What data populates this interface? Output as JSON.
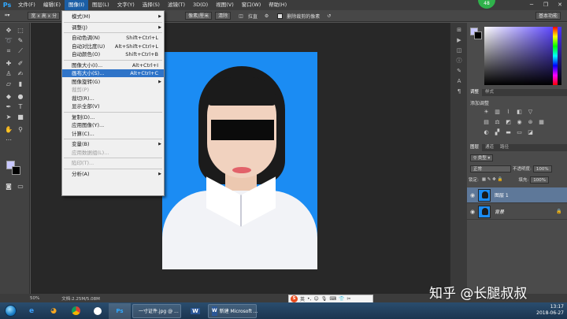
{
  "app": {
    "logo": "Ps"
  },
  "menubar": {
    "items": [
      "文件(F)",
      "编辑(E)",
      "图像(I)",
      "图层(L)",
      "文字(Y)",
      "选择(S)",
      "滤镜(T)",
      "3D(D)",
      "视图(V)",
      "窗口(W)",
      "帮助(H)"
    ],
    "active_index": 2,
    "notification_badge": "48"
  },
  "options_bar": {
    "ratio": "宽 x 高 x 分",
    "unit": "像素/厘米",
    "clear_label": "清除",
    "straighten_label": "拉直",
    "delete_cropped_label": "删除裁剪的像素",
    "workspace": "基本功能"
  },
  "image_menu": {
    "items": [
      {
        "label": "模式(M)",
        "shortcut": "",
        "submenu": true
      },
      {
        "sep": true
      },
      {
        "label": "调整(J)",
        "shortcut": "",
        "submenu": true
      },
      {
        "sep": true
      },
      {
        "label": "自动色调(N)",
        "shortcut": "Shift+Ctrl+L"
      },
      {
        "label": "自动对比度(U)",
        "shortcut": "Alt+Shift+Ctrl+L"
      },
      {
        "label": "自动颜色(O)",
        "shortcut": "Shift+Ctrl+B"
      },
      {
        "sep": true
      },
      {
        "label": "图像大小(I)...",
        "shortcut": "Alt+Ctrl+I"
      },
      {
        "label": "画布大小(S)...",
        "shortcut": "Alt+Ctrl+C",
        "highlight": true
      },
      {
        "label": "图像旋转(G)",
        "shortcut": "",
        "submenu": true
      },
      {
        "label": "裁剪(P)",
        "shortcut": "",
        "disabled": true
      },
      {
        "label": "裁切(R)...",
        "shortcut": ""
      },
      {
        "label": "显示全部(V)",
        "shortcut": ""
      },
      {
        "sep": true
      },
      {
        "label": "复制(D)...",
        "shortcut": ""
      },
      {
        "label": "应用图像(Y)...",
        "shortcut": ""
      },
      {
        "label": "计算(C)...",
        "shortcut": ""
      },
      {
        "sep": true
      },
      {
        "label": "变量(B)",
        "shortcut": "",
        "submenu": true
      },
      {
        "label": "应用数据组(L)...",
        "shortcut": "",
        "disabled": true
      },
      {
        "sep": true
      },
      {
        "label": "陷印(T)...",
        "shortcut": "",
        "disabled": true
      },
      {
        "sep": true
      },
      {
        "label": "分析(A)",
        "shortcut": "",
        "submenu": true
      }
    ]
  },
  "adjustments_panel": {
    "tabs": [
      "调整",
      "样式"
    ],
    "title": "添加调整"
  },
  "layers_panel": {
    "tabs": [
      "图层",
      "通道",
      "路径"
    ],
    "kind_filter": "类型",
    "blend_mode": "正常",
    "opacity_label": "不透明度:",
    "opacity_value": "100%",
    "lock_label": "锁定:",
    "fill_label": "填充:",
    "fill_value": "100%",
    "layers": [
      {
        "name": "图层 1",
        "selected": true,
        "italic": false,
        "locked": false
      },
      {
        "name": "背景",
        "selected": false,
        "italic": true,
        "locked": true
      }
    ]
  },
  "status_bar": {
    "zoom": "50%",
    "doc_info": "文档:2.25M/5.08M"
  },
  "watermark": "知乎 @长腿叔叔",
  "ime": {
    "mode": "英"
  },
  "taskbar": {
    "buttons": [
      {
        "icon": "Ps",
        "label": ""
      },
      {
        "icon": "",
        "label": "一寸证件.jpg @ ..."
      },
      {
        "icon": "W",
        "label": ""
      },
      {
        "icon": "",
        "label": "新建 Microsoft ..."
      }
    ],
    "time": "13:17",
    "date": "2018-06-27"
  },
  "colors": {
    "photo_bg": "#1b8cf3",
    "menu_highlight": "#2f74c8",
    "foreground": "#c8c8ff",
    "background": "#000000"
  }
}
